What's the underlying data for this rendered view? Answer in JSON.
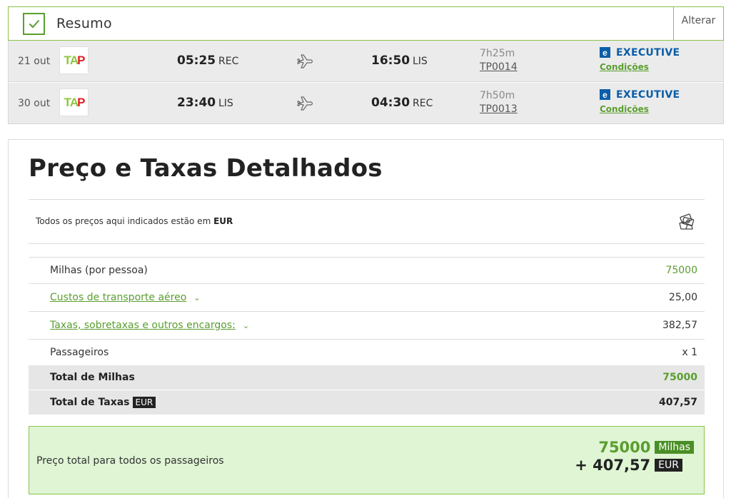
{
  "summary": {
    "title": "Resumo",
    "alter_label": "Alterar"
  },
  "flights": [
    {
      "date": "21 out",
      "airline_logo": "TAP",
      "dep_time": "05:25",
      "dep_code": "REC",
      "arr_time": "16:50",
      "arr_code": "LIS",
      "duration": "7h25m",
      "flight_no": "TP0014",
      "cabin_icon": "e",
      "cabin": "EXECUTIVE",
      "conditions": "Condições"
    },
    {
      "date": "30 out",
      "airline_logo": "TAP",
      "dep_time": "23:40",
      "dep_code": "LIS",
      "arr_time": "04:30",
      "arr_code": "REC",
      "duration": "7h50m",
      "flight_no": "TP0013",
      "cabin_icon": "e",
      "cabin": "EXECUTIVE",
      "conditions": "Condições"
    }
  ],
  "details": {
    "title": "Preço e Taxas Detalhados",
    "currency_note_prefix": "Todos os preços aqui indicados estão em",
    "currency": "EUR",
    "rows": [
      {
        "label": "Milhas (por pessoa)",
        "value": "75000"
      },
      {
        "label": "Custos de transporte aéreo",
        "value": "25,00"
      },
      {
        "label": "Taxas, sobretaxas e outros encargos:",
        "value": "382,57"
      },
      {
        "label": "Passageiros",
        "value": "x 1"
      }
    ],
    "total_miles_label": "Total de Milhas",
    "total_miles_value": "75000",
    "total_fees_label": "Total de Taxas",
    "total_fees_badge": "EUR",
    "total_fees_value": "407,57"
  },
  "grand_total": {
    "label": "Preço total para todos os passageiros",
    "miles": "75000",
    "miles_badge": "Milhas",
    "fees": "+ 407,57",
    "fees_badge": "EUR"
  },
  "colors": {
    "accent_green": "#5a9e2f",
    "border_green": "#8bc34a",
    "executive_blue": "#0a5ea8",
    "total_bg": "#dff5d4"
  },
  "icons": [
    "check-icon",
    "plane-icon",
    "money-icon",
    "chevron-down-icon"
  ]
}
